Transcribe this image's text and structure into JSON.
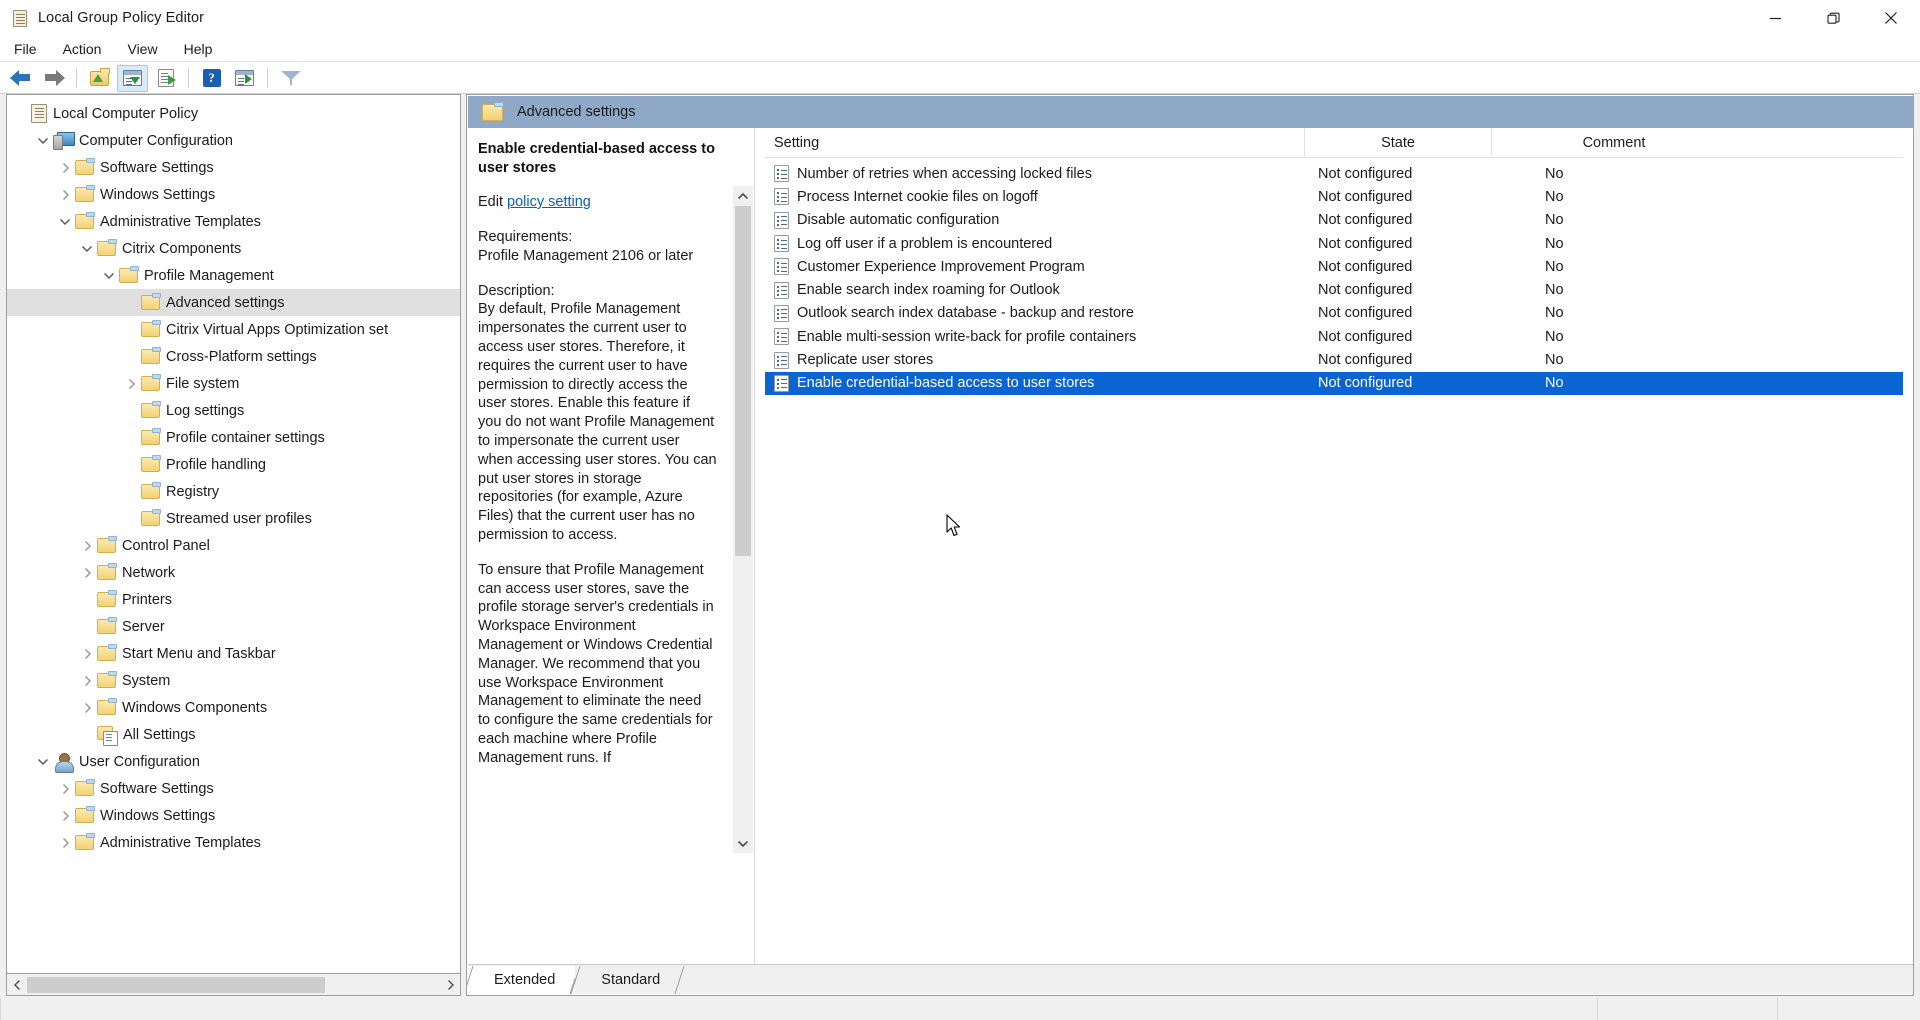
{
  "window": {
    "title": "Local Group Policy Editor",
    "icon": "policy-document-icon",
    "minimize": "minimize",
    "restore": "restore",
    "close": "close"
  },
  "menubar": {
    "items": [
      {
        "label": "File"
      },
      {
        "label": "Action"
      },
      {
        "label": "View"
      },
      {
        "label": "Help"
      }
    ]
  },
  "toolbar": {
    "buttons": [
      {
        "name": "back-button",
        "icon": "back-arrow-icon"
      },
      {
        "name": "forward-button",
        "icon": "forward-arrow-icon"
      },
      {
        "name": "up-one-level-button",
        "icon": "folder-up-icon"
      },
      {
        "name": "show-hide-console-tree-button",
        "icon": "console-tree-icon"
      },
      {
        "name": "export-list-button",
        "icon": "export-list-icon"
      },
      {
        "name": "help-button",
        "icon": "help-icon"
      },
      {
        "name": "show-hide-action-pane-button",
        "icon": "action-pane-icon"
      },
      {
        "name": "filter-button",
        "icon": "filter-icon"
      }
    ]
  },
  "tree": {
    "items": [
      {
        "label": "Local Computer Policy",
        "indent": 0,
        "icon": "policy-document-icon",
        "chevron": "none",
        "selected": false
      },
      {
        "label": "Computer Configuration",
        "indent": 1,
        "icon": "computer-icon",
        "chevron": "down",
        "selected": false
      },
      {
        "label": "Software Settings",
        "indent": 2,
        "icon": "folder-icon",
        "chevron": "right",
        "selected": false
      },
      {
        "label": "Windows Settings",
        "indent": 2,
        "icon": "folder-icon",
        "chevron": "right",
        "selected": false
      },
      {
        "label": "Administrative Templates",
        "indent": 2,
        "icon": "folder-icon",
        "chevron": "down",
        "selected": false
      },
      {
        "label": "Citrix Components",
        "indent": 3,
        "icon": "folder-icon",
        "chevron": "down",
        "selected": false
      },
      {
        "label": "Profile Management",
        "indent": 4,
        "icon": "folder-icon",
        "chevron": "down",
        "selected": false
      },
      {
        "label": "Advanced settings",
        "indent": 5,
        "icon": "folder-icon",
        "chevron": "none",
        "selected": true
      },
      {
        "label": "Citrix Virtual Apps Optimization set",
        "indent": 5,
        "icon": "folder-icon",
        "chevron": "none",
        "selected": false
      },
      {
        "label": "Cross-Platform settings",
        "indent": 5,
        "icon": "folder-icon",
        "chevron": "none",
        "selected": false
      },
      {
        "label": "File system",
        "indent": 5,
        "icon": "folder-icon",
        "chevron": "right",
        "selected": false
      },
      {
        "label": "Log settings",
        "indent": 5,
        "icon": "folder-icon",
        "chevron": "none",
        "selected": false
      },
      {
        "label": "Profile container settings",
        "indent": 5,
        "icon": "folder-icon",
        "chevron": "none",
        "selected": false
      },
      {
        "label": "Profile handling",
        "indent": 5,
        "icon": "folder-icon",
        "chevron": "none",
        "selected": false
      },
      {
        "label": "Registry",
        "indent": 5,
        "icon": "folder-icon",
        "chevron": "none",
        "selected": false
      },
      {
        "label": "Streamed user profiles",
        "indent": 5,
        "icon": "folder-icon",
        "chevron": "none",
        "selected": false
      },
      {
        "label": "Control Panel",
        "indent": 3,
        "icon": "folder-icon",
        "chevron": "right",
        "selected": false
      },
      {
        "label": "Network",
        "indent": 3,
        "icon": "folder-icon",
        "chevron": "right",
        "selected": false
      },
      {
        "label": "Printers",
        "indent": 3,
        "icon": "folder-icon",
        "chevron": "none",
        "selected": false
      },
      {
        "label": "Server",
        "indent": 3,
        "icon": "folder-icon",
        "chevron": "none",
        "selected": false
      },
      {
        "label": "Start Menu and Taskbar",
        "indent": 3,
        "icon": "folder-icon",
        "chevron": "right",
        "selected": false
      },
      {
        "label": "System",
        "indent": 3,
        "icon": "folder-icon",
        "chevron": "right",
        "selected": false
      },
      {
        "label": "Windows Components",
        "indent": 3,
        "icon": "folder-icon",
        "chevron": "right",
        "selected": false
      },
      {
        "label": "All Settings",
        "indent": 3,
        "icon": "all-settings-icon",
        "chevron": "none",
        "selected": false
      },
      {
        "label": "User Configuration",
        "indent": 1,
        "icon": "user-icon",
        "chevron": "down",
        "selected": false
      },
      {
        "label": "Software Settings",
        "indent": 2,
        "icon": "folder-icon",
        "chevron": "right",
        "selected": false
      },
      {
        "label": "Windows Settings",
        "indent": 2,
        "icon": "folder-icon",
        "chevron": "right",
        "selected": false
      },
      {
        "label": "Administrative Templates",
        "indent": 2,
        "icon": "folder-icon",
        "chevron": "right",
        "selected": false
      }
    ]
  },
  "pane": {
    "header_title": "Advanced settings",
    "header_icon": "folder-icon"
  },
  "description": {
    "title": "Enable credential-based access to user stores",
    "edit_prefix": "Edit",
    "edit_link": "policy setting",
    "requirements_label": "Requirements:",
    "requirements_value": "Profile Management 2106 or later",
    "description_label": "Description:",
    "paragraph1": "By default, Profile Management impersonates the current user to access user stores. Therefore, it requires the current user to have permission to directly access the user stores. Enable this feature if you do not want Profile Management to impersonate the current user when accessing user stores. You can put user stores in storage repositories (for example, Azure Files) that the current user has no permission to access.",
    "paragraph2": "To ensure that Profile Management can access user stores, save the profile storage server's credentials in Workspace Environment Management or Windows Credential Manager. We recommend that you use Workspace Environment Management to eliminate the need to configure the same credentials for each machine where Profile Management runs. If"
  },
  "settings_list": {
    "columns": [
      {
        "label": "Setting"
      },
      {
        "label": "State"
      },
      {
        "label": "Comment"
      }
    ],
    "rows": [
      {
        "setting": "Number of retries when accessing locked files",
        "state": "Not configured",
        "comment": "No",
        "selected": false
      },
      {
        "setting": "Process Internet cookie files on logoff",
        "state": "Not configured",
        "comment": "No",
        "selected": false
      },
      {
        "setting": "Disable automatic configuration",
        "state": "Not configured",
        "comment": "No",
        "selected": false
      },
      {
        "setting": "Log off user if a problem is encountered",
        "state": "Not configured",
        "comment": "No",
        "selected": false
      },
      {
        "setting": "Customer Experience Improvement Program",
        "state": "Not configured",
        "comment": "No",
        "selected": false
      },
      {
        "setting": "Enable search index roaming for Outlook",
        "state": "Not configured",
        "comment": "No",
        "selected": false
      },
      {
        "setting": "Outlook search index database - backup and restore",
        "state": "Not configured",
        "comment": "No",
        "selected": false
      },
      {
        "setting": "Enable multi-session write-back for profile containers",
        "state": "Not configured",
        "comment": "No",
        "selected": false
      },
      {
        "setting": "Replicate user stores",
        "state": "Not configured",
        "comment": "No",
        "selected": false
      },
      {
        "setting": "Enable credential-based access to user stores",
        "state": "Not configured",
        "comment": "No",
        "selected": true
      }
    ]
  },
  "tabs": {
    "items": [
      {
        "label": "Extended",
        "active": true
      },
      {
        "label": "Standard",
        "active": false
      }
    ]
  },
  "colors": {
    "selection_blue": "#0a64d2",
    "pane_header_blue": "#8fa8c8",
    "link_blue": "#0a5fbd"
  }
}
